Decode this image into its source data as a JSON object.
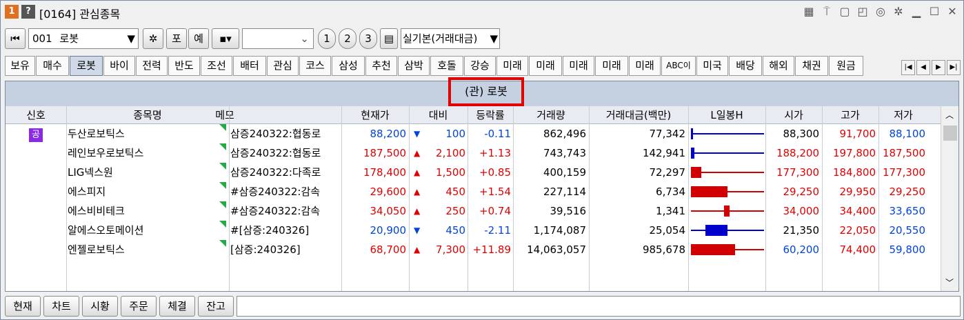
{
  "window": {
    "badge1": "1",
    "badge2": "?",
    "title": "[0164] 관심종목"
  },
  "toolbar": {
    "group_no": "001",
    "group_name": "로봇",
    "btn_po": "포",
    "btn_ye": "예",
    "btn_1": "1",
    "btn_2": "2",
    "btn_3": "3",
    "view_select": "실기본(거래대금)"
  },
  "tabs": [
    "보유",
    "매수",
    "로봇",
    "바이",
    "전력",
    "반도",
    "조선",
    "배터",
    "관심",
    "코스",
    "삼성",
    "추천",
    "삼박",
    "호돌",
    "강승",
    "미래",
    "미래",
    "미래",
    "미래",
    "미래",
    "ABC이",
    "미국",
    "배당",
    "해외",
    "채권",
    "원금"
  ],
  "active_tab": 2,
  "group_title": "(관) 로봇",
  "columns": [
    "신호",
    "종목명",
    "메모",
    "현재가",
    "대비",
    "등락률",
    "거래량",
    "거래대금(백만)",
    "L일봉H",
    "시가",
    "고가",
    "저가"
  ],
  "rows": [
    {
      "signal": "공",
      "name": "두산로보틱스",
      "memo": "삼증240322:협동로",
      "price": "88,200",
      "dir": "▼",
      "change": "100",
      "rate": "-0.11",
      "volume": "862,496",
      "amount": "77,342",
      "open": "88,300",
      "high": "91,700",
      "low": "88,100",
      "pc": "blue",
      "oc": "",
      "hc": "red",
      "lc": "blue"
    },
    {
      "signal": "",
      "name": "레인보우로보틱스",
      "memo": "삼증240322:협동로",
      "price": "187,500",
      "dir": "▲",
      "change": "2,100",
      "rate": "+1.13",
      "volume": "743,743",
      "amount": "142,941",
      "open": "188,200",
      "high": "197,800",
      "low": "187,500",
      "pc": "red",
      "oc": "red",
      "hc": "red",
      "lc": "red"
    },
    {
      "signal": "",
      "name": "LIG넥스원",
      "memo": "삼증240322:다족로",
      "price": "178,400",
      "dir": "▲",
      "change": "1,500",
      "rate": "+0.85",
      "volume": "400,159",
      "amount": "72,297",
      "open": "177,300",
      "high": "184,800",
      "low": "177,300",
      "pc": "red",
      "oc": "red",
      "hc": "red",
      "lc": "red"
    },
    {
      "signal": "",
      "name": "에스피지",
      "memo": "#삼증240322:감속",
      "price": "29,600",
      "dir": "▲",
      "change": "450",
      "rate": "+1.54",
      "volume": "227,114",
      "amount": "6,734",
      "open": "29,250",
      "high": "29,950",
      "low": "29,250",
      "pc": "red",
      "oc": "red",
      "hc": "red",
      "lc": "red"
    },
    {
      "signal": "",
      "name": "에스비비테크",
      "memo": "#삼증240322:감속",
      "price": "34,050",
      "dir": "▲",
      "change": "250",
      "rate": "+0.74",
      "volume": "39,516",
      "amount": "1,341",
      "open": "34,000",
      "high": "34,400",
      "low": "33,650",
      "pc": "red",
      "oc": "red",
      "hc": "red",
      "lc": "blue"
    },
    {
      "signal": "",
      "name": "알에스오토메이션",
      "memo": "#[삼증:240326]",
      "price": "20,900",
      "dir": "▼",
      "change": "450",
      "rate": "-2.11",
      "volume": "1,174,087",
      "amount": "25,054",
      "open": "21,350",
      "high": "22,050",
      "low": "20,550",
      "pc": "blue",
      "oc": "",
      "hc": "red",
      "lc": "blue"
    },
    {
      "signal": "",
      "name": "엔젤로보틱스",
      "memo": "[삼증:240326]",
      "price": "68,700",
      "dir": "▲",
      "change": "7,300",
      "rate": "+11.89",
      "volume": "14,063,057",
      "amount": "985,678",
      "open": "60,200",
      "high": "74,400",
      "low": "59,800",
      "pc": "red",
      "oc": "blue",
      "hc": "red",
      "lc": "blue"
    }
  ],
  "bottom_tabs": [
    "현재",
    "차트",
    "시황",
    "주문",
    "체결",
    "잔고"
  ],
  "colors": {
    "up": "#e00000",
    "down": "#0044dd",
    "header_bg": "#c5d0e0",
    "highlight_border": "#e00000"
  }
}
